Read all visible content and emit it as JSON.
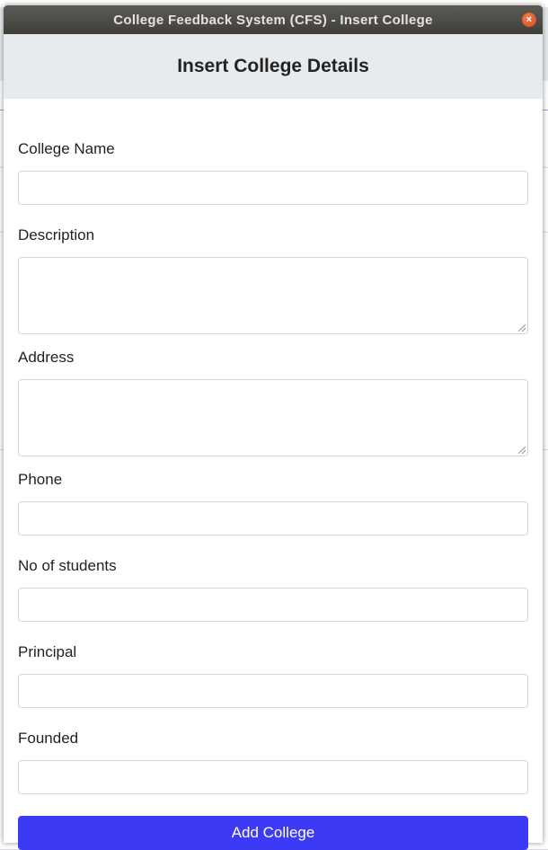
{
  "window": {
    "title": "College Feedback System (CFS) - Insert College",
    "close_glyph": "×"
  },
  "header": {
    "title": "Insert College Details"
  },
  "form": {
    "fields": [
      {
        "label": "College Name",
        "value": ""
      },
      {
        "label": "Description",
        "value": ""
      },
      {
        "label": "Address",
        "value": ""
      },
      {
        "label": "Phone",
        "value": ""
      },
      {
        "label": "No of students",
        "value": ""
      },
      {
        "label": "Principal",
        "value": ""
      },
      {
        "label": "Founded",
        "value": ""
      }
    ],
    "submit_label": "Add College"
  },
  "colors": {
    "primary_button": "#3d3af5",
    "header_bg": "#e8ebee",
    "titlebar_bg": "#4a4945"
  }
}
